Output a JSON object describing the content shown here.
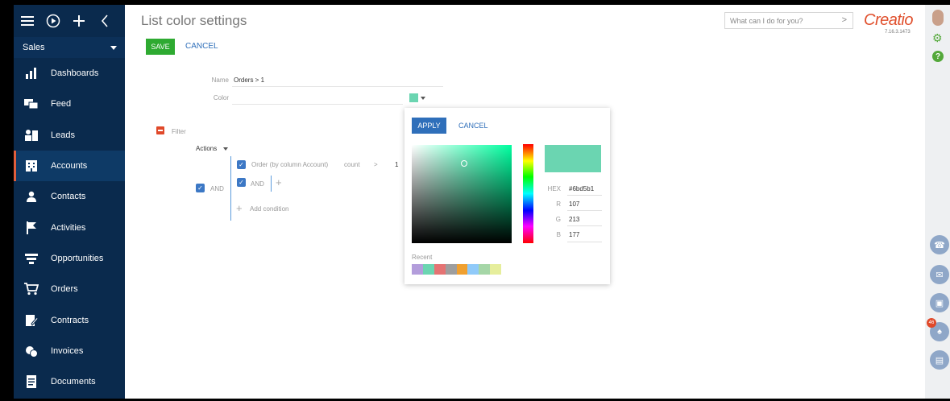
{
  "nav_top": {
    "menu_icon": "hamburger-icon",
    "play_icon": "play-circle-icon",
    "add_icon": "plus-icon",
    "collapse_icon": "chevron-left-icon"
  },
  "workspace": {
    "label": "Sales"
  },
  "sidebar": {
    "items": [
      {
        "label": "Dashboards",
        "icon": "bar-chart-icon"
      },
      {
        "label": "Feed",
        "icon": "feed-icon"
      },
      {
        "label": "Leads",
        "icon": "leads-icon"
      },
      {
        "label": "Accounts",
        "icon": "building-icon",
        "active": true
      },
      {
        "label": "Contacts",
        "icon": "person-icon"
      },
      {
        "label": "Activities",
        "icon": "flag-icon"
      },
      {
        "label": "Opportunities",
        "icon": "funnel-icon"
      },
      {
        "label": "Orders",
        "icon": "cart-icon"
      },
      {
        "label": "Contracts",
        "icon": "contract-icon"
      },
      {
        "label": "Invoices",
        "icon": "invoice-icon"
      },
      {
        "label": "Documents",
        "icon": "document-icon"
      }
    ]
  },
  "header": {
    "title": "List color settings",
    "save_label": "SAVE",
    "cancel_label": "CANCEL",
    "search_placeholder": "What can I do for you?",
    "logo_text": "Creatio",
    "version": "7.16.3.1473"
  },
  "form": {
    "name_label": "Name",
    "name_value": "Orders > 1",
    "color_label": "Color",
    "color_value": "#6bd5b1"
  },
  "filter": {
    "title": "Filter",
    "actions_label": "Actions",
    "and_outer": "AND",
    "condition_column": "Order (by column Account)",
    "condition_function": "count",
    "condition_operator": ">",
    "condition_value": "1",
    "and_inner": "AND",
    "add_condition": "Add condition"
  },
  "picker": {
    "apply_label": "APPLY",
    "cancel_label": "CANCEL",
    "hue_readout": "0",
    "hex_label": "HEX",
    "hex_value": "#6bd5b1",
    "r_label": "R",
    "r_value": "107",
    "g_label": "G",
    "g_value": "213",
    "b_label": "B",
    "b_value": "177",
    "recent_label": "Recent",
    "recent_colors": [
      "#b39ddb",
      "#6bd5b1",
      "#e57373",
      "#9e9e9e",
      "#f0a030",
      "#90caf9",
      "#a5d6a7",
      "#e6ee9c"
    ]
  },
  "right_rail": {
    "notification_count": "46",
    "icons": [
      "avatar-icon",
      "gear-icon",
      "help-icon",
      "phone-icon",
      "email-icon",
      "chat-icon",
      "bell-icon",
      "feed-icon"
    ]
  },
  "colors": {
    "sidebar_bg": "#0a2a4d",
    "accent_orange": "#e04f2c",
    "save_green": "#2eaa31",
    "link_blue": "#2f6fba"
  }
}
